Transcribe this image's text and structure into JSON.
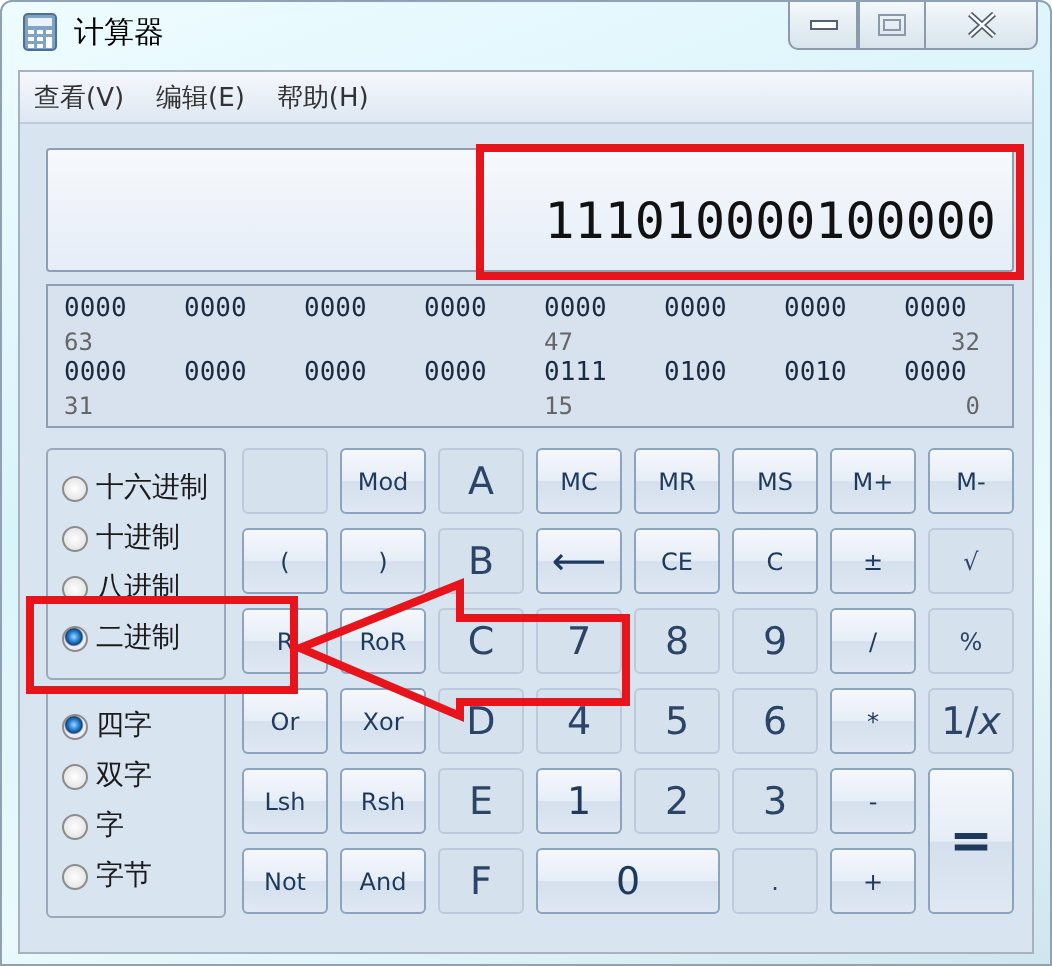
{
  "window": {
    "title": "计算器"
  },
  "menu": [
    "查看(V)",
    "编辑(E)",
    "帮助(H)"
  ],
  "display": {
    "value": "111010000100000"
  },
  "bits": [
    {
      "groups": [
        "0000",
        "0000",
        "0000",
        "0000",
        "0000",
        "0000",
        "0000",
        "0000"
      ],
      "labels": [
        "63",
        "47",
        "32"
      ]
    },
    {
      "groups": [
        "0000",
        "0000",
        "0000",
        "0000",
        "0111",
        "0100",
        "0010",
        "0000"
      ],
      "labels": [
        "31",
        "15",
        "0"
      ]
    }
  ],
  "radix": [
    {
      "label": "十六进制",
      "selected": false
    },
    {
      "label": "十进制",
      "selected": false
    },
    {
      "label": "八进制",
      "selected": false
    },
    {
      "label": "二进制",
      "selected": true
    }
  ],
  "word_size": [
    {
      "label": "四字",
      "selected": true
    },
    {
      "label": "双字",
      "selected": false
    },
    {
      "label": "字",
      "selected": false
    },
    {
      "label": "字节",
      "selected": false
    }
  ],
  "buttons": [
    {
      "kind": "key",
      "disabled": true
    },
    {
      "label": "Mod",
      "kind": "key",
      "disabled": false
    },
    {
      "label": "A",
      "kind": "digit",
      "disabled": true
    },
    {
      "label": "MC",
      "kind": "key",
      "disabled": false
    },
    {
      "label": "MR",
      "kind": "key",
      "disabled": false
    },
    {
      "label": "MS",
      "kind": "key",
      "disabled": false
    },
    {
      "label": "M+",
      "kind": "key",
      "disabled": false
    },
    {
      "label": "M-",
      "kind": "key",
      "disabled": false
    },
    {
      "label": "(",
      "kind": "key",
      "disabled": false
    },
    {
      "label": ")",
      "kind": "key",
      "disabled": false
    },
    {
      "label": "B",
      "kind": "digit",
      "disabled": true
    },
    {
      "label": "⟵",
      "kind": "digit",
      "disabled": false
    },
    {
      "label": "CE",
      "kind": "key",
      "disabled": false
    },
    {
      "label": "C",
      "kind": "key",
      "disabled": false
    },
    {
      "label": "±",
      "kind": "key",
      "disabled": false
    },
    {
      "label": "√",
      "kind": "key",
      "disabled": true
    },
    {
      "label": "R",
      "kind": "key",
      "disabled": false
    },
    {
      "label": "RoR",
      "kind": "key",
      "disabled": false
    },
    {
      "label": "C",
      "kind": "digit",
      "disabled": true
    },
    {
      "label": "7",
      "kind": "digit",
      "disabled": true
    },
    {
      "label": "8",
      "kind": "digit",
      "disabled": true
    },
    {
      "label": "9",
      "kind": "digit",
      "disabled": true
    },
    {
      "label": "/",
      "kind": "key",
      "disabled": false
    },
    {
      "label": "%",
      "kind": "key",
      "disabled": true
    },
    {
      "label": "Or",
      "kind": "key",
      "disabled": false
    },
    {
      "label": "Xor",
      "kind": "key",
      "disabled": false
    },
    {
      "label": "D",
      "kind": "digit",
      "disabled": true
    },
    {
      "label": "4",
      "kind": "digit",
      "disabled": true
    },
    {
      "label": "5",
      "kind": "digit",
      "disabled": true
    },
    {
      "label": "6",
      "kind": "digit",
      "disabled": true
    },
    {
      "label": "*",
      "kind": "key",
      "disabled": false
    },
    {
      "label": "1/*x*",
      "kind": "digit",
      "disabled": true
    },
    {
      "label": "Lsh",
      "kind": "key",
      "disabled": false
    },
    {
      "label": "Rsh",
      "kind": "key",
      "disabled": false
    },
    {
      "label": "E",
      "kind": "digit",
      "disabled": true
    },
    {
      "label": "1",
      "kind": "digit",
      "disabled": false
    },
    {
      "label": "2",
      "kind": "digit",
      "disabled": true
    },
    {
      "label": "3",
      "kind": "digit",
      "disabled": true
    },
    {
      "label": "-",
      "kind": "key",
      "disabled": false
    },
    {
      "label": "=",
      "kind": "tall",
      "disabled": false
    },
    {
      "label": "Not",
      "kind": "key",
      "disabled": false
    },
    {
      "label": "And",
      "kind": "key",
      "disabled": false
    },
    {
      "label": "F",
      "kind": "digit",
      "disabled": true
    },
    {
      "label": "0",
      "kind": "wide",
      "disabled": false
    },
    {
      "label": ".",
      "kind": "key",
      "disabled": true
    },
    {
      "label": "+",
      "kind": "key",
      "disabled": false
    }
  ]
}
